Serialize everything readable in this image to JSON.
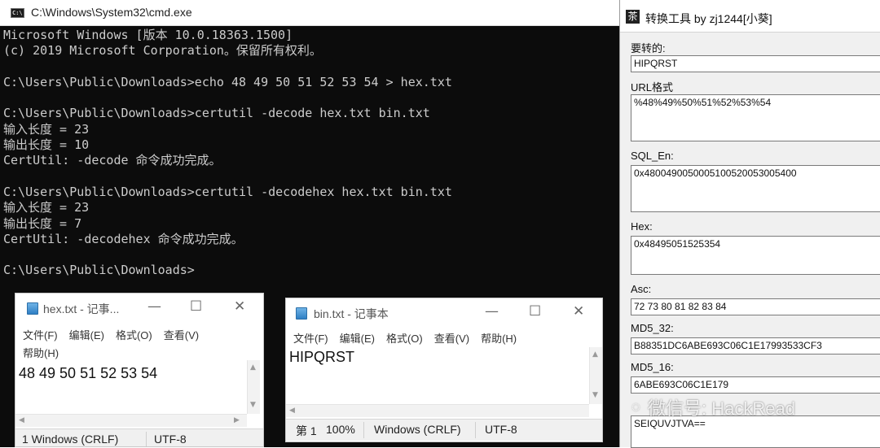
{
  "cmd": {
    "title": "C:\\Windows\\System32\\cmd.exe",
    "icon_label": "C:\\",
    "lines": [
      "Microsoft Windows [版本 10.0.18363.1500]",
      "(c) 2019 Microsoft Corporation。保留所有权利。",
      "",
      "C:\\Users\\Public\\Downloads>echo 48 49 50 51 52 53 54 > hex.txt",
      "",
      "C:\\Users\\Public\\Downloads>certutil -decode hex.txt bin.txt",
      "输入长度 = 23",
      "输出长度 = 10",
      "CertUtil: -decode 命令成功完成。",
      "",
      "C:\\Users\\Public\\Downloads>certutil -decodehex hex.txt bin.txt",
      "输入长度 = 23",
      "输出长度 = 7",
      "CertUtil: -decodehex 命令成功完成。",
      "",
      "C:\\Users\\Public\\Downloads>"
    ]
  },
  "notepad_hex": {
    "title": "hex.txt - 记事...",
    "menu": [
      "文件(F)",
      "编辑(E)",
      "格式(O)",
      "查看(V)"
    ],
    "menu_help": "帮助(H)",
    "content": "48 49 50 51 52 53 54",
    "status_line_ending": "1  Windows (CRLF)",
    "status_encoding": "UTF-8"
  },
  "notepad_bin": {
    "title": "bin.txt - 记事本",
    "menu": [
      "文件(F)",
      "编辑(E)",
      "格式(O)",
      "查看(V)",
      "帮助(H)"
    ],
    "content": "HIPQRST",
    "status_position": "第 1",
    "status_zoom": "100%",
    "status_line_ending": "Windows (CRLF)",
    "status_encoding": "UTF-8"
  },
  "tool": {
    "icon_glyph": "茶",
    "title": "转换工具 by zj1244[小葵]",
    "fields": [
      {
        "label": "要转的:",
        "value": "HIPQRST"
      },
      {
        "label": "URL格式",
        "value": "%48%49%50%51%52%53%54"
      },
      {
        "label": "SQL_En:",
        "value": "0x480049005000510052005300540​0"
      },
      {
        "label": "Hex:",
        "value": "0x48495051525354"
      },
      {
        "label": "Asc:",
        "value": "72 73 80 81 82 83 84"
      },
      {
        "label": "MD5_32:",
        "value": "B88351DC6ABE693C06C1E17993533CF3"
      },
      {
        "label": "MD5_16:",
        "value": "6ABE693C06C1E179"
      },
      {
        "label": "",
        "value": "SEIQUVJTVA=="
      }
    ]
  },
  "watermark": {
    "text": "微信号: HackRead"
  }
}
